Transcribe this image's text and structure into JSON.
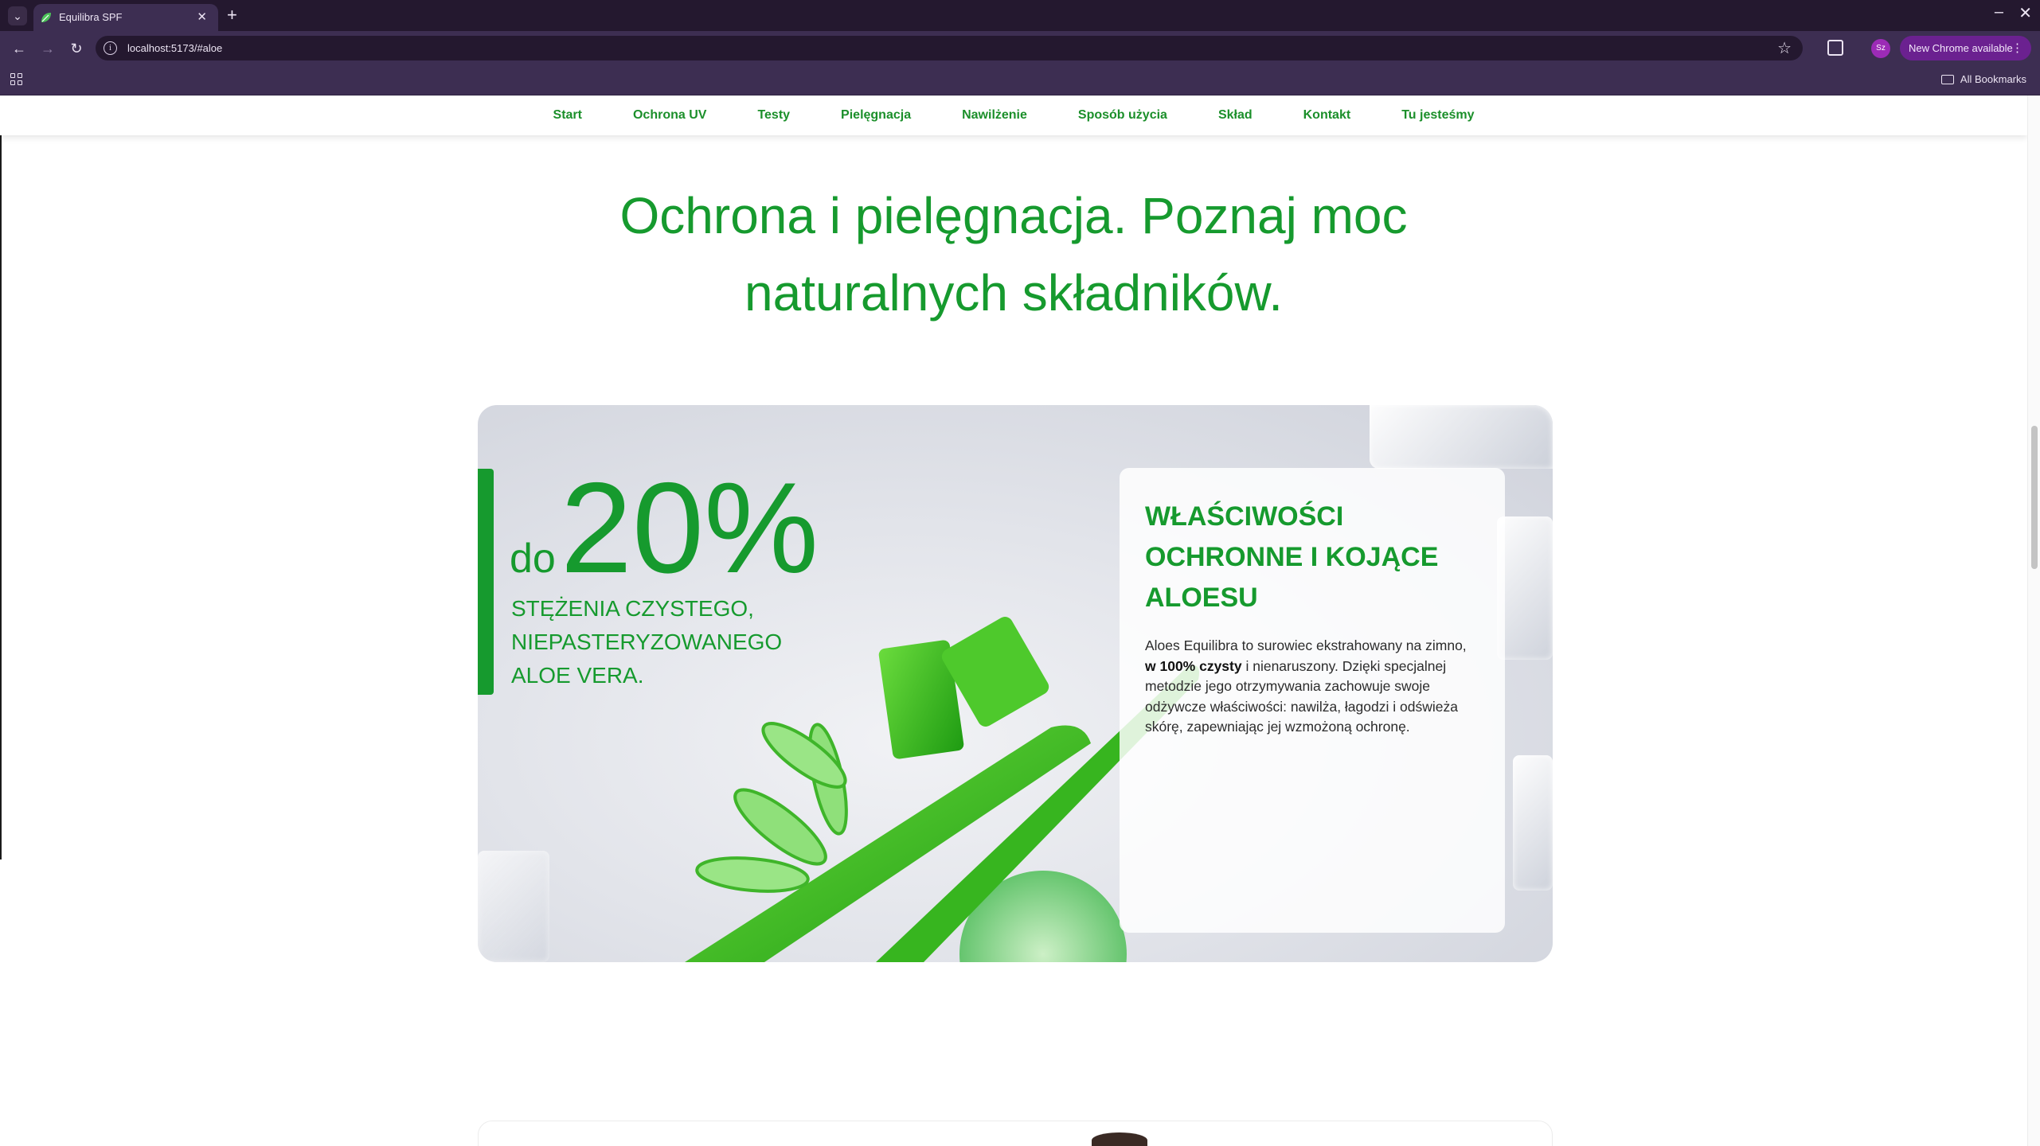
{
  "browser": {
    "tab_title": "Equilibra SPF",
    "url": "localhost:5173/#aloe",
    "profile_initials": "Sz",
    "update_label": "New Chrome available",
    "bookmarks_label": "All Bookmarks"
  },
  "site": {
    "nav": [
      "Start",
      "Ochrona UV",
      "Testy",
      "Pielęgnacja",
      "Nawilżenie",
      "Sposób użycia",
      "Skład",
      "Kontakt",
      "Tu jesteśmy"
    ],
    "heading": "Ochrona i pielęgnacja. Poznaj moc naturalnych składników.",
    "stat": {
      "prefix": "do",
      "value": "20%",
      "description": "STĘŻENIA CZYSTEGO, NIEPASTERYZOWANEGO ALOE VERA."
    },
    "card": {
      "title": "WŁAŚCIWOŚCI OCHRONNE I KOJĄCE ALOESU",
      "text_before": "Aloes Equilibra to surowiec ekstrahowany na zimno, ",
      "text_bold": "w 100% czysty",
      "text_after": " i nienaruszony. Dzięki specjalnej metodzie jego otrzymywania zachowuje swoje odżywcze właściwości: nawilża, łagodzi i odświeża skórę, zapewniając jej wzmożoną ochronę."
    }
  },
  "colors": {
    "brand_green": "#169a2e",
    "nav_green": "#1b8f2a",
    "browser_dark": "#24182f",
    "browser_toolbar": "#3d2e52",
    "update_pill": "#6b2190"
  },
  "icons": [
    "tab-search-icon",
    "leaf-favicon-icon",
    "close-icon",
    "plus-icon",
    "minimize-icon",
    "back-arrow-icon",
    "forward-arrow-icon",
    "reload-icon",
    "site-info-icon",
    "star-icon",
    "extensions-icon",
    "apps-grid-icon",
    "folder-icon",
    "more-vert-icon"
  ]
}
